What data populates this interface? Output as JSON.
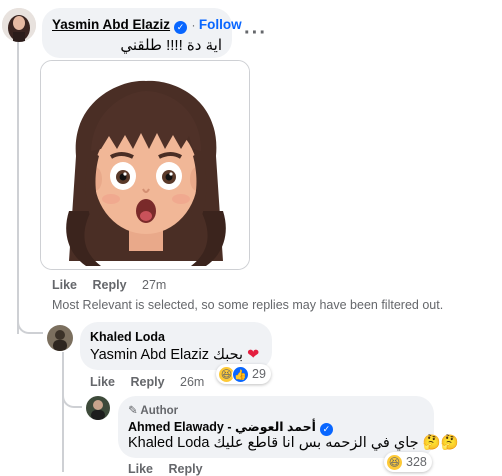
{
  "comment1": {
    "author": "Yasmin Abd Elaziz",
    "follow_label": "Follow",
    "text": "اية دة !!!! طلقني",
    "more_icon": "more-options-icon",
    "actions": {
      "like": "Like",
      "reply": "Reply",
      "time": "27m"
    }
  },
  "filter_note": "Most Relevant is selected, so some replies may have been filtered out.",
  "reply1": {
    "author": "Khaled Loda",
    "mention": "Yasmin Abd Elaziz",
    "text": "بحبك",
    "actions": {
      "like": "Like",
      "reply": "Reply",
      "time": "26m"
    },
    "reaction_count": "29"
  },
  "reply2": {
    "badge": "Author",
    "author": "Ahmed Elawady - أحمد العوضي",
    "mention": "Khaled Loda",
    "text": "جاي في الزحمه بس انا قاطع عليك",
    "actions": {
      "like": "Like",
      "reply": "Reply"
    },
    "reaction_count": "328"
  },
  "colors": {
    "accent": "#0866ff",
    "bubble": "#f0f2f5",
    "muted": "#65676b"
  }
}
